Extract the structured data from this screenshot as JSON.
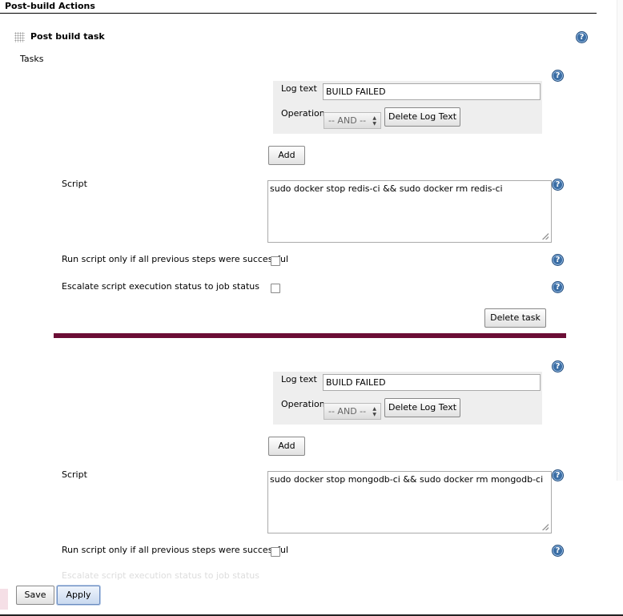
{
  "section": {
    "title": "Post-build Actions"
  },
  "block": {
    "title": "Post build task",
    "tasks_label": "Tasks"
  },
  "tasks": [
    {
      "log_text_label": "Log text",
      "log_text_value": "BUILD FAILED",
      "operation_label": "Operation",
      "operation_value": "-- AND --",
      "delete_log_text_button": "Delete Log Text",
      "add_button": "Add",
      "script_label": "Script",
      "script_value": "sudo docker stop redis-ci && sudo docker rm redis-ci",
      "run_only_if_success_label": "Run script only if all previous steps were successful",
      "escalate_label": "Escalate script execution status to job status",
      "delete_task_button": "Delete task"
    },
    {
      "log_text_label": "Log text",
      "log_text_value": "BUILD FAILED",
      "operation_label": "Operation",
      "operation_value": "-- AND --",
      "delete_log_text_button": "Delete Log Text",
      "add_button": "Add",
      "script_label": "Script",
      "script_value": "sudo docker stop mongodb-ci && sudo docker rm mongodb-ci",
      "run_only_if_success_label": "Run script only if all previous steps were successful",
      "escalate_label": "Escalate script execution status to job status"
    }
  ],
  "help_icon_glyph": "?",
  "bottom": {
    "save_button": "Save",
    "apply_button": "Apply"
  },
  "colors": {
    "divider": "#6b0d35",
    "help_icon": "#3b6ea5"
  }
}
